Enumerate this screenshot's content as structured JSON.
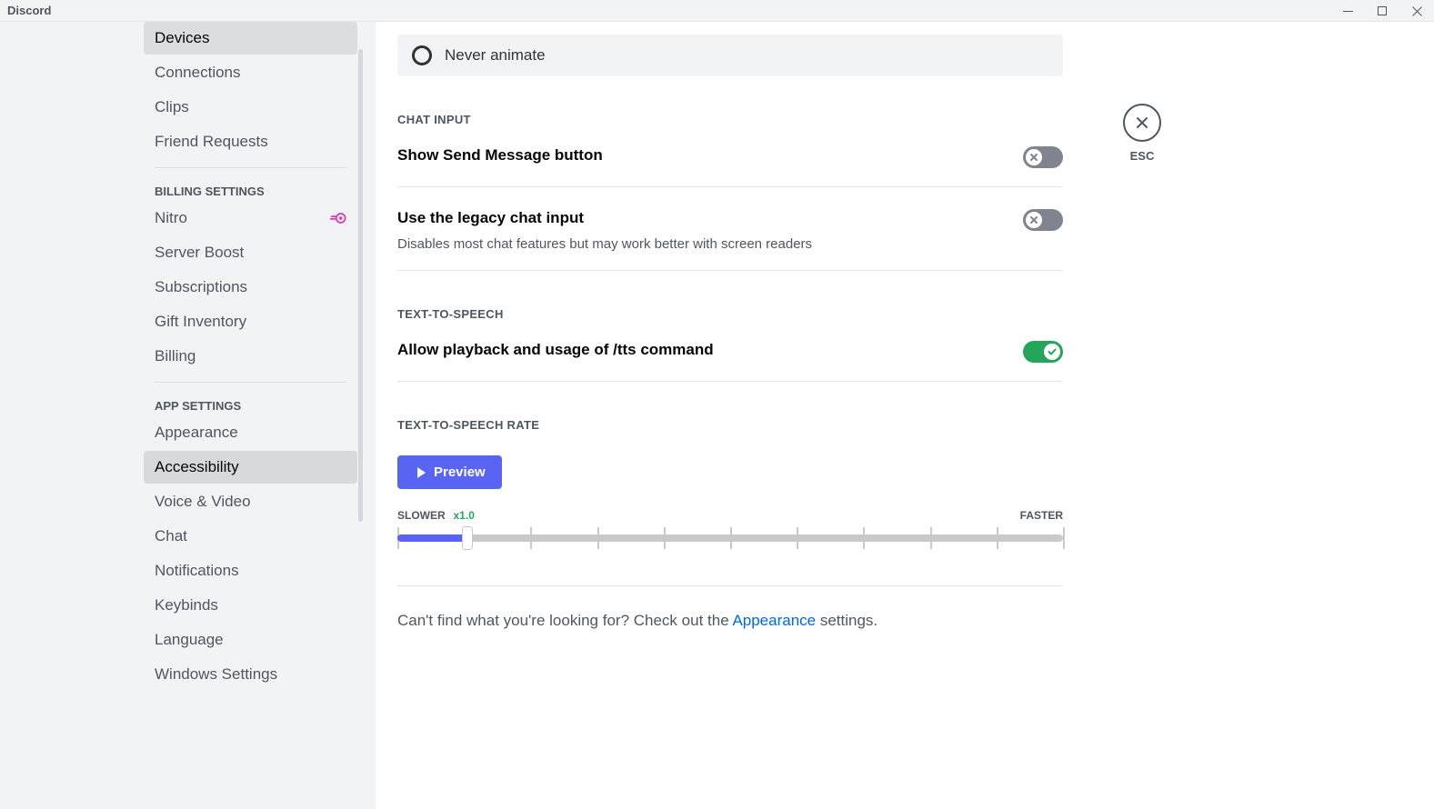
{
  "app": {
    "title": "Discord"
  },
  "close": {
    "esc": "ESC"
  },
  "sidebar": {
    "user_settings": [
      {
        "label": "Devices"
      },
      {
        "label": "Connections"
      },
      {
        "label": "Clips"
      },
      {
        "label": "Friend Requests"
      }
    ],
    "billing_header": "Billing Settings",
    "billing": [
      {
        "label": "Nitro"
      },
      {
        "label": "Server Boost"
      },
      {
        "label": "Subscriptions"
      },
      {
        "label": "Gift Inventory"
      },
      {
        "label": "Billing"
      }
    ],
    "app_header": "App Settings",
    "app": [
      {
        "label": "Appearance"
      },
      {
        "label": "Accessibility"
      },
      {
        "label": "Voice & Video"
      },
      {
        "label": "Chat"
      },
      {
        "label": "Notifications"
      },
      {
        "label": "Keybinds"
      },
      {
        "label": "Language"
      },
      {
        "label": "Windows Settings"
      }
    ]
  },
  "content": {
    "radio_never_animate": "Never animate",
    "chat_input_header": "Chat Input",
    "show_send_button": "Show Send Message button",
    "legacy_chat": {
      "label": "Use the legacy chat input",
      "desc": "Disables most chat features but may work better with screen readers"
    },
    "tts_header": "Text-to-Speech",
    "tts_allow": "Allow playback and usage of /tts command",
    "tts_rate_header": "Text-to-Speech Rate",
    "preview": "Preview",
    "slider": {
      "slower": "SLOWER",
      "faster": "FASTER",
      "current": "x1.0"
    },
    "footer": {
      "prefix": "Can't find what you're looking for? Check out the ",
      "link": "Appearance",
      "suffix": " settings."
    }
  }
}
